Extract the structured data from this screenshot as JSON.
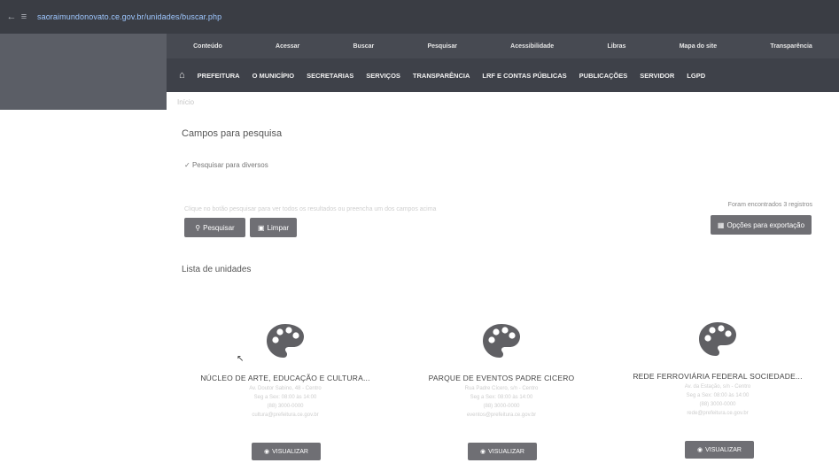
{
  "browser": {
    "url": "saoraimundonovato.ce.gov.br/unidades/buscar.php"
  },
  "topbar": {
    "items": [
      "Conteúdo",
      "Acessar",
      "Buscar",
      "Pesquisar",
      "Acessibilidade",
      "Libras",
      "Mapa do site",
      "Transparência"
    ]
  },
  "mainnav": {
    "items": [
      "PREFEITURA",
      "O MUNICÍPIO",
      "SECRETARIAS",
      "SERVIÇOS",
      "TRANSPARÊNCIA",
      "LRF E CONTAS PÚBLICAS",
      "PUBLICAÇÕES",
      "SERVIDOR",
      "LGPD"
    ]
  },
  "breadcrumb": "Início",
  "search": {
    "title": "Campos para pesquisa",
    "checkbox_label": "Pesquisar para diversos",
    "hint": "Clique no botão pesquisar para ver todos os resultados ou preencha um dos campos acima",
    "search_label": "Pesquisar",
    "clear_label": "Limpar",
    "found_text": "Foram encontrados 3 registros",
    "export_label": "Opções para exportação"
  },
  "list": {
    "title": "Lista de unidades",
    "view_label": "VISUALIZAR",
    "cards": [
      {
        "title": "NÚCLEO DE ARTE, EDUCAÇÃO E CULTURA...",
        "address": "Av. Doutor Sabino, 48 - Centro",
        "hours": "Seg a Sex: 08:00 às 14:00",
        "phone": "(88) 3000-0000",
        "email": "cultura@prefeitura.ce.gov.br"
      },
      {
        "title": "PARQUE DE EVENTOS PADRE CICERO",
        "address": "Rua Padre Cícero, s/n - Centro",
        "hours": "Seg a Sex: 08:00 às 14:00",
        "phone": "(88) 3000-0000",
        "email": "eventos@prefeitura.ce.gov.br"
      },
      {
        "title": "REDE FERROVIÁRIA FEDERAL SOCIEDADE...",
        "address": "Av. da Estação, s/n - Centro",
        "hours": "Seg a Sex: 08:00 às 14:00",
        "phone": "(88) 3000-0000",
        "email": "rede@prefeitura.ce.gov.br"
      }
    ]
  }
}
